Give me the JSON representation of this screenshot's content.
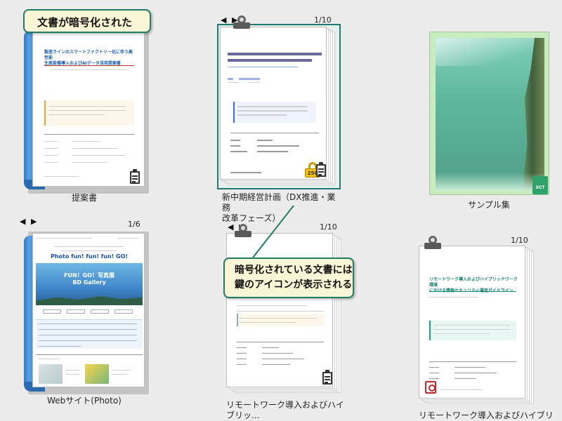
{
  "callouts": {
    "top": "文書が暗号化された",
    "middle_line1": "暗号化されている文書には",
    "middle_line2": "鍵のアイコンが表示される"
  },
  "items": {
    "proposal": {
      "caption": "提案書",
      "title": "製造ラインのスマートファクトリー化に伴う高性能\n生産設備導入およびAIデータ活用提案書"
    },
    "midterm": {
      "caption_line1": "新中期経営計画（DX推進・業務",
      "caption_line2": "改革フェーズ）",
      "page": "1/10",
      "lock_label": "256",
      "title": "新中期経営計画 DX推進・業務改革フェーズ"
    },
    "sample": {
      "caption": "サンプル集",
      "badge": "XCT"
    },
    "website": {
      "caption": "Webサイト(Photo)",
      "page": "1/6",
      "headline": "Photo fun! fun! fun! GO!",
      "hero_line1": "FUN！GO！写真展",
      "hero_line2": "BD Gallery"
    },
    "remote1": {
      "caption": "リモートワーク導入およびハイブリッ...",
      "page": "1/10"
    },
    "remote2": {
      "caption": "リモートワーク導入およびハイブリッ...",
      "page": "1/10",
      "title": "リモートワーク導入およびハイブリッドワーク環境\nにおける情報セキュリティ運用ガイドライン"
    }
  },
  "nav_arrows": "◀ ▶",
  "colors": {
    "callout_border": "#1f7a66",
    "callout_bg": "#fbf7d6",
    "binder_blue": "#3c86cf",
    "lock_yellow": "#f2c10f",
    "selection": "#1f7a73"
  }
}
